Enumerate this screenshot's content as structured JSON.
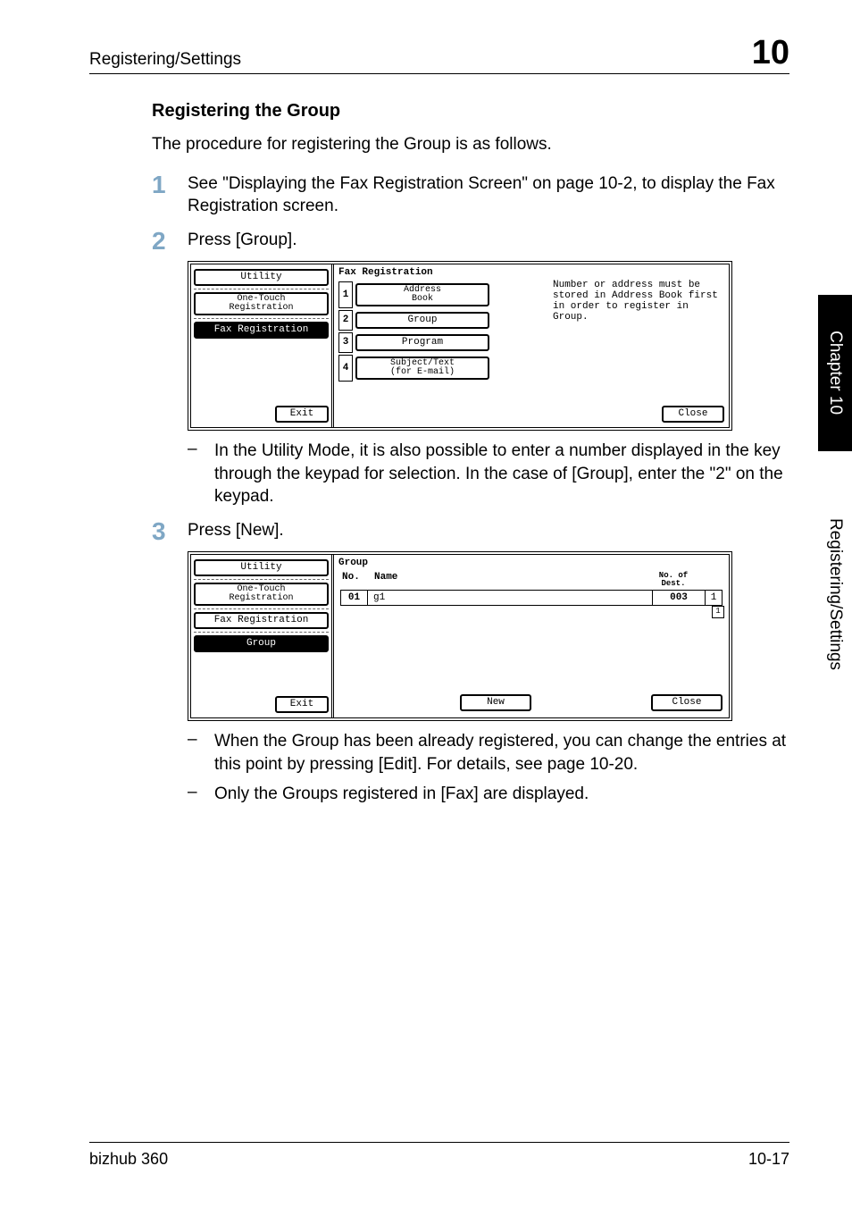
{
  "header": {
    "left": "Registering/Settings",
    "right": "10"
  },
  "section_title": "Registering the Group",
  "intro": "The procedure for registering the Group is as follows.",
  "steps": {
    "s1": {
      "num": "1",
      "text": "See \"Displaying the Fax Registration Screen\" on page 10-2, to display the Fax Registration screen."
    },
    "s2": {
      "num": "2",
      "text": "Press [Group]."
    },
    "s3": {
      "num": "3",
      "text": "Press [New]."
    }
  },
  "subnotes": {
    "n1": "In the Utility Mode, it is also possible to enter a number displayed in the key through the keypad for selection. In the case of [Group], enter the \"2\" on the keypad.",
    "n2": "When the Group has been already registered, you can change the entries at this point by pressing [Edit]. For details, see page 10-20.",
    "n3": "Only the Groups registered in [Fax] are displayed."
  },
  "panel1": {
    "left": {
      "utility": "Utility",
      "onetouch": "One-Touch\nRegistration",
      "faxreg": "Fax Registration",
      "exit": "Exit"
    },
    "right": {
      "title": "Fax Registration",
      "r1": "Address\nBook",
      "r2": "Group",
      "r3": "Program",
      "r4": "Subject/Text\n(for E-mail)",
      "msg": "Number or address must be stored in Address Book first in order to register in Group.",
      "close": "Close"
    }
  },
  "panel2": {
    "left": {
      "utility": "Utility",
      "onetouch": "One-Touch\nRegistration",
      "faxreg": "Fax Registration",
      "group": "Group",
      "exit": "Exit"
    },
    "right": {
      "title": "Group",
      "head_no": "No.",
      "head_name": "Name",
      "head_dest": "No. of\nDest.",
      "row_no": "01",
      "row_name": "g1",
      "row_dest": "003",
      "row_page": "1",
      "scroll_total": "1",
      "new_btn": "New",
      "close": "Close"
    }
  },
  "side": {
    "chapter": "Chapter 10",
    "section": "Registering/Settings"
  },
  "footer": {
    "left": "bizhub 360",
    "right": "10-17"
  }
}
